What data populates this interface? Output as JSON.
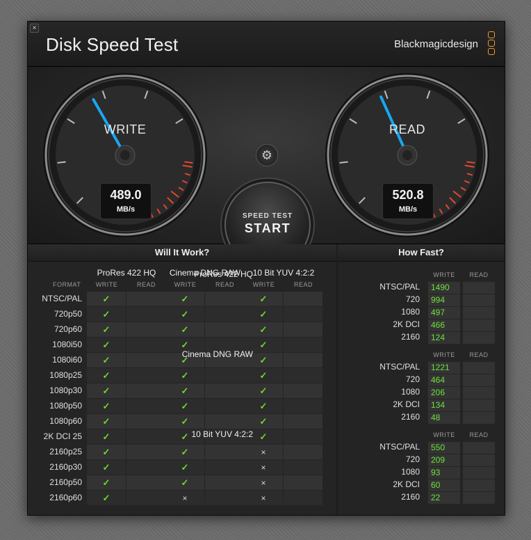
{
  "window": {
    "title": "Disk Speed Test",
    "brand": "Blackmagicdesign",
    "close_glyph": "×"
  },
  "gauges": {
    "write": {
      "label": "WRITE",
      "value": "489.0",
      "unit": "MB/s",
      "needle_fraction": 0.39
    },
    "read": {
      "label": "READ",
      "value": "520.8",
      "unit": "MB/s",
      "needle_fraction": 0.41
    }
  },
  "controls": {
    "settings_icon": "gear-icon",
    "start_small": "SPEED TEST",
    "start_big": "START"
  },
  "will_it_work": {
    "title": "Will It Work?",
    "format_header": "FORMAT",
    "write_header": "WRITE",
    "read_header": "READ",
    "groups": [
      "ProRes 422 HQ",
      "Cinema DNG RAW",
      "10 Bit YUV 4:2:2"
    ],
    "rows": [
      {
        "format": "NTSC/PAL",
        "marks": [
          "✓",
          "✓",
          "✓"
        ]
      },
      {
        "format": "720p50",
        "marks": [
          "✓",
          "✓",
          "✓"
        ]
      },
      {
        "format": "720p60",
        "marks": [
          "✓",
          "✓",
          "✓"
        ]
      },
      {
        "format": "1080i50",
        "marks": [
          "✓",
          "✓",
          "✓"
        ]
      },
      {
        "format": "1080i60",
        "marks": [
          "✓",
          "✓",
          "✓"
        ]
      },
      {
        "format": "1080p25",
        "marks": [
          "✓",
          "✓",
          "✓"
        ]
      },
      {
        "format": "1080p30",
        "marks": [
          "✓",
          "✓",
          "✓"
        ]
      },
      {
        "format": "1080p50",
        "marks": [
          "✓",
          "✓",
          "✓"
        ]
      },
      {
        "format": "1080p60",
        "marks": [
          "✓",
          "✓",
          "✓"
        ]
      },
      {
        "format": "2K DCI 25",
        "marks": [
          "✓",
          "✓",
          "✓"
        ]
      },
      {
        "format": "2160p25",
        "marks": [
          "✓",
          "✓",
          "×"
        ]
      },
      {
        "format": "2160p30",
        "marks": [
          "✓",
          "✓",
          "×"
        ]
      },
      {
        "format": "2160p50",
        "marks": [
          "✓",
          "✓",
          "×"
        ]
      },
      {
        "format": "2160p60",
        "marks": [
          "✓",
          "×",
          "×"
        ]
      }
    ]
  },
  "how_fast": {
    "title": "How Fast?",
    "write_header": "WRITE",
    "read_header": "READ",
    "groups": [
      {
        "name": "ProRes 422 HQ",
        "rows": [
          {
            "format": "NTSC/PAL",
            "write": "1490"
          },
          {
            "format": "720",
            "write": "994"
          },
          {
            "format": "1080",
            "write": "497"
          },
          {
            "format": "2K DCI",
            "write": "466"
          },
          {
            "format": "2160",
            "write": "124"
          }
        ]
      },
      {
        "name": "Cinema DNG RAW",
        "rows": [
          {
            "format": "NTSC/PAL",
            "write": "1221"
          },
          {
            "format": "720",
            "write": "464"
          },
          {
            "format": "1080",
            "write": "206"
          },
          {
            "format": "2K DCI",
            "write": "134"
          },
          {
            "format": "2160",
            "write": "48"
          }
        ]
      },
      {
        "name": "10 Bit YUV 4:2:2",
        "rows": [
          {
            "format": "NTSC/PAL",
            "write": "550"
          },
          {
            "format": "720",
            "write": "209"
          },
          {
            "format": "1080",
            "write": "93"
          },
          {
            "format": "2K DCI",
            "write": "60"
          },
          {
            "format": "2160",
            "write": "22"
          }
        ]
      }
    ]
  },
  "colors": {
    "accent_green": "#69dd28",
    "needle_blue": "#1aa6f0",
    "redline": "#e2472c",
    "logo_orange": "#f09a2f"
  }
}
